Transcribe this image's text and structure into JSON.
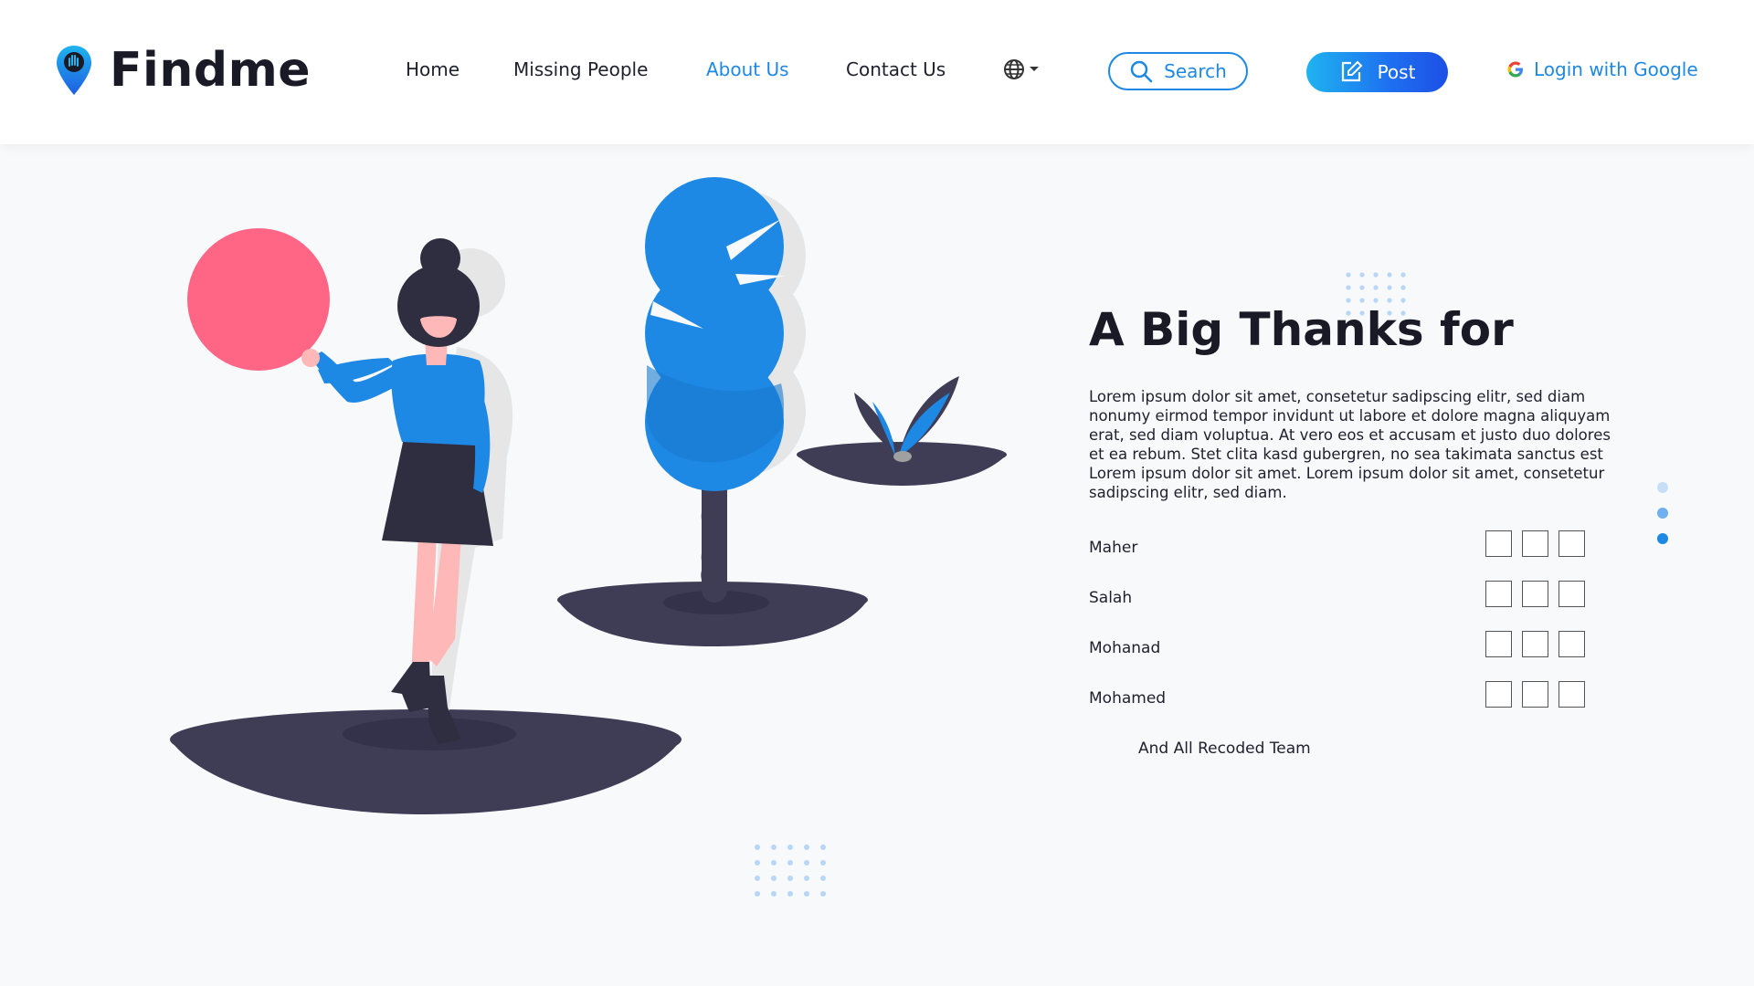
{
  "brand": {
    "name": "Findme",
    "accent": "#1e88e5"
  },
  "nav": {
    "home": "Home",
    "missing_people": "Missing People",
    "about_us": "About Us",
    "contact_us": "Contact Us",
    "language_icon": "globe-icon"
  },
  "actions": {
    "search_label": "Search",
    "post_label": "Post",
    "login_label": "Login with Google"
  },
  "main": {
    "heading": "A Big Thanks for",
    "paragraph": "Lorem ipsum dolor sit amet, consetetur sadipscing elitr, sed diam nonumy eirmod tempor invidunt ut labore et dolore magna aliquyam erat, sed diam voluptua. At vero eos et accusam et justo duo dolores et ea rebum. Stet clita kasd gubergren, no sea takimata sanctus est Lorem ipsum dolor sit amet. Lorem ipsum dolor sit amet, consetetur sadipscing elitr, sed diam.",
    "members": [
      {
        "name": "Maher"
      },
      {
        "name": "Salah"
      },
      {
        "name": "Mohanad"
      },
      {
        "name": "Mohamed"
      }
    ],
    "team_line": "And All Recoded Team"
  },
  "pager": {
    "count": 3,
    "active_index": 2
  }
}
